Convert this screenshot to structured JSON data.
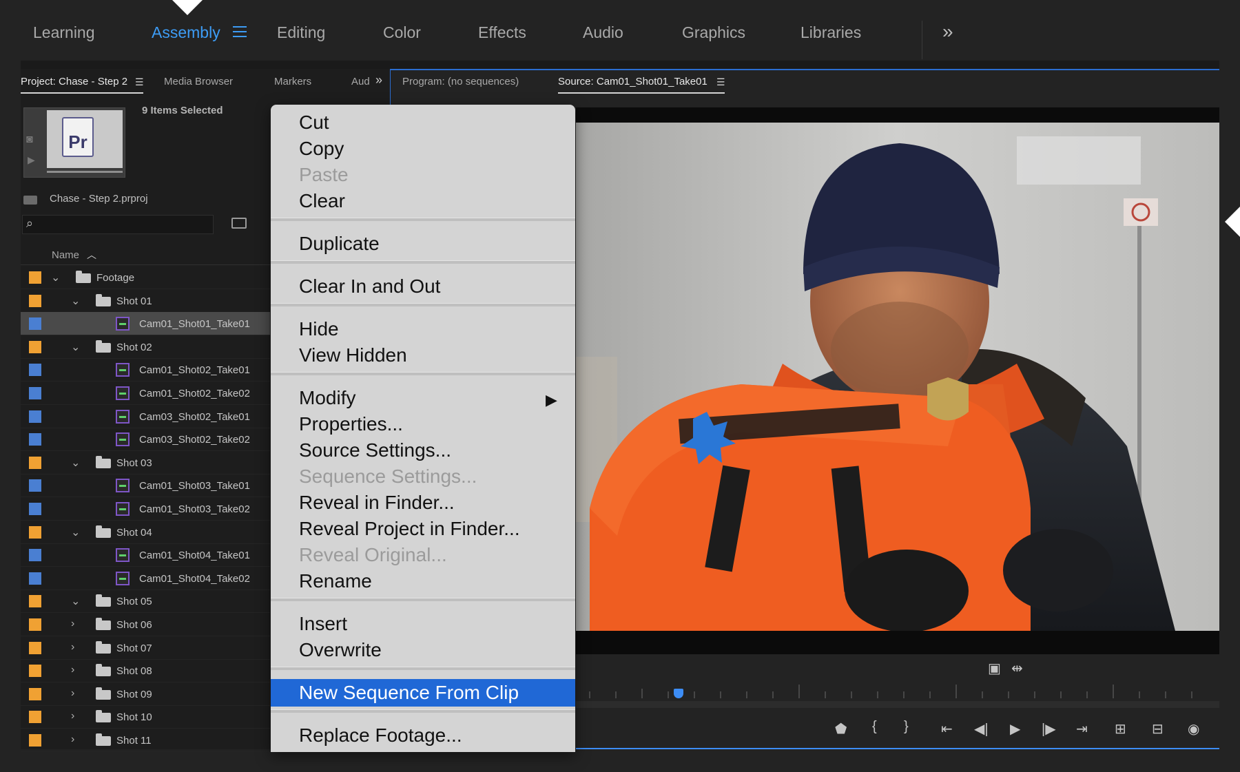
{
  "workspaces": {
    "tabs": [
      "Learning",
      "Assembly",
      "Editing",
      "Color",
      "Effects",
      "Audio",
      "Graphics",
      "Libraries"
    ],
    "active": "Assembly",
    "overflow": "»"
  },
  "project_panel": {
    "tabs": [
      "Project: Chase - Step 2",
      "Media Browser",
      "Markers",
      "Aud"
    ],
    "menu_icon": "hamburger-icon",
    "selection_status": "9 Items Selected",
    "project_file": "Chase - Step 2.prproj",
    "search": {
      "placeholder": ""
    },
    "column_header": "Name",
    "items": [
      {
        "name": "Footage",
        "kind": "bin",
        "chip": "orange",
        "expanded": true
      },
      {
        "name": "Shot 01",
        "kind": "bin",
        "chip": "orange",
        "expanded": true
      },
      {
        "name": "Cam01_Shot01_Take01",
        "kind": "clip",
        "chip": "blue",
        "selected": true
      },
      {
        "name": "Shot 02",
        "kind": "bin",
        "chip": "orange",
        "expanded": true
      },
      {
        "name": "Cam01_Shot02_Take01",
        "kind": "clip",
        "chip": "blue"
      },
      {
        "name": "Cam01_Shot02_Take02",
        "kind": "clip",
        "chip": "blue"
      },
      {
        "name": "Cam03_Shot02_Take01",
        "kind": "clip",
        "chip": "blue"
      },
      {
        "name": "Cam03_Shot02_Take02",
        "kind": "clip",
        "chip": "blue"
      },
      {
        "name": "Shot 03",
        "kind": "bin",
        "chip": "orange",
        "expanded": true
      },
      {
        "name": "Cam01_Shot03_Take01",
        "kind": "clip",
        "chip": "blue"
      },
      {
        "name": "Cam01_Shot03_Take02",
        "kind": "clip",
        "chip": "blue"
      },
      {
        "name": "Shot 04",
        "kind": "bin",
        "chip": "orange",
        "expanded": true
      },
      {
        "name": "Cam01_Shot04_Take01",
        "kind": "clip",
        "chip": "blue"
      },
      {
        "name": "Cam01_Shot04_Take02",
        "kind": "clip",
        "chip": "blue"
      },
      {
        "name": "Shot 05",
        "kind": "bin",
        "chip": "orange",
        "expanded": true
      },
      {
        "name": "Shot 06",
        "kind": "bin",
        "chip": "orange",
        "expanded": false
      },
      {
        "name": "Shot 07",
        "kind": "bin",
        "chip": "orange",
        "expanded": false
      },
      {
        "name": "Shot 08",
        "kind": "bin",
        "chip": "orange",
        "expanded": false
      },
      {
        "name": "Shot 09",
        "kind": "bin",
        "chip": "orange",
        "expanded": false
      },
      {
        "name": "Shot 10",
        "kind": "bin",
        "chip": "orange",
        "expanded": false
      },
      {
        "name": "Shot 11",
        "kind": "bin",
        "chip": "orange",
        "expanded": false
      }
    ]
  },
  "monitor_panel": {
    "tabs": [
      "Program: (no sequences)",
      "Source: Cam01_Shot01_Take01"
    ],
    "active_tab": "Source: Cam01_Shot01_Take01"
  },
  "context_menu": {
    "groups": [
      [
        {
          "label": "Cut"
        },
        {
          "label": "Copy"
        },
        {
          "label": "Paste",
          "disabled": true
        },
        {
          "label": "Clear"
        }
      ],
      [
        {
          "label": "Duplicate"
        }
      ],
      [
        {
          "label": "Clear In and Out"
        }
      ],
      [
        {
          "label": "Hide"
        },
        {
          "label": "View Hidden"
        }
      ],
      [
        {
          "label": "Modify",
          "submenu": true
        },
        {
          "label": "Properties..."
        },
        {
          "label": "Source Settings..."
        },
        {
          "label": "Sequence Settings...",
          "disabled": true
        },
        {
          "label": "Reveal in Finder..."
        },
        {
          "label": "Reveal Project in Finder..."
        },
        {
          "label": "Reveal Original...",
          "disabled": true
        },
        {
          "label": "Rename"
        }
      ],
      [
        {
          "label": "Insert"
        },
        {
          "label": "Overwrite"
        }
      ],
      [
        {
          "label": "New Sequence From Clip",
          "highlighted": true
        }
      ],
      [
        {
          "label": "Replace Footage..."
        }
      ]
    ]
  },
  "colors": {
    "accent": "#3d9cf5",
    "label_orange": "#f0a133",
    "label_blue": "#4a7fd2",
    "menu_highlight": "#2068d6"
  },
  "transport_icons": [
    "add-marker-icon",
    "mark-in-icon",
    "mark-out-icon",
    "go-to-in-icon",
    "step-back-icon",
    "play-icon",
    "step-forward-icon",
    "go-to-out-icon",
    "insert-icon",
    "overwrite-icon",
    "export-frame-icon"
  ]
}
